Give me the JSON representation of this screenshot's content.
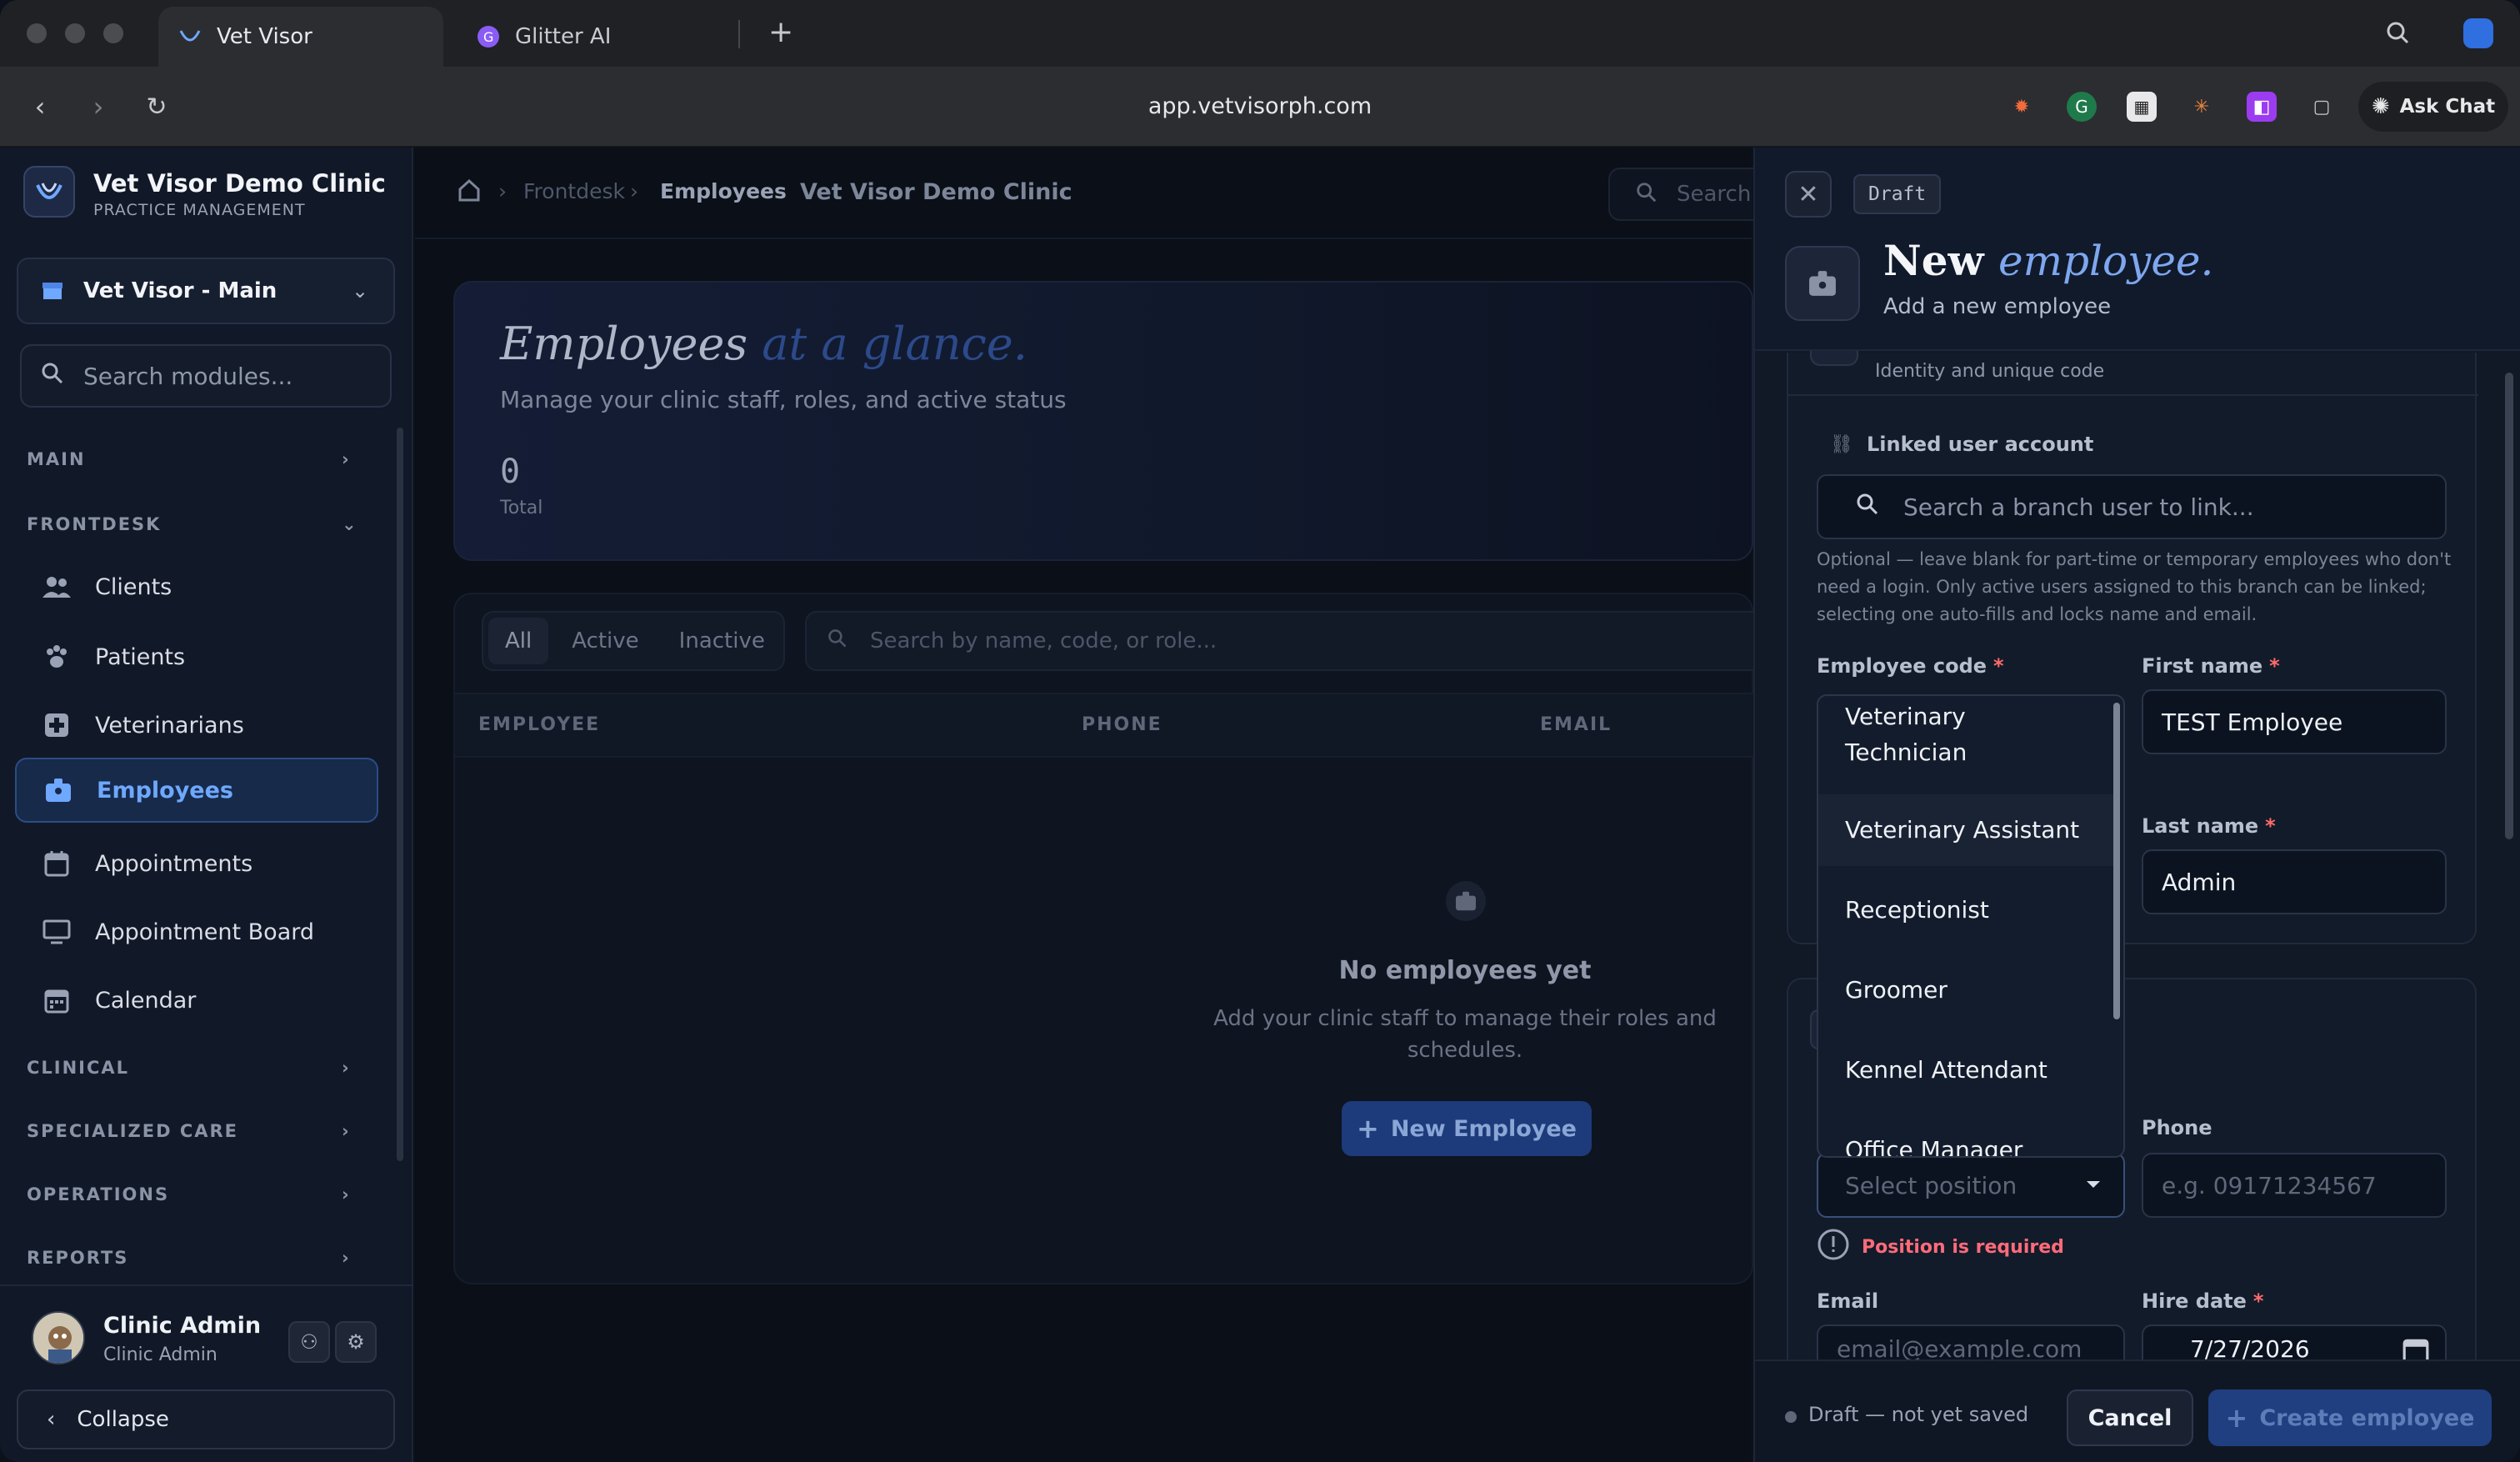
{
  "browser": {
    "tabs": [
      {
        "label": "Vet Visor",
        "active": true
      },
      {
        "label": "Glitter AI",
        "active": false
      }
    ],
    "url": "app.vetvisorph.com",
    "ask_chat": "Ask Chat"
  },
  "sidebar": {
    "brand_title": "Vet Visor Demo Clinic",
    "brand_sub": "PRACTICE MANAGEMENT",
    "branch": "Vet Visor - Main",
    "search_placeholder": "Search modules...",
    "sections": {
      "main": "MAIN",
      "frontdesk": "FRONTDESK",
      "clinical": "CLINICAL",
      "specialized": "SPECIALIZED CARE",
      "operations": "OPERATIONS",
      "reports": "REPORTS"
    },
    "items": [
      {
        "label": "Clients",
        "icon": "users-icon"
      },
      {
        "label": "Patients",
        "icon": "paw-icon"
      },
      {
        "label": "Veterinarians",
        "icon": "medical-cross-icon"
      },
      {
        "label": "Employees",
        "icon": "badge-icon",
        "selected": true
      },
      {
        "label": "Appointments",
        "icon": "calendar-icon"
      },
      {
        "label": "Appointment Board",
        "icon": "monitor-icon"
      },
      {
        "label": "Calendar",
        "icon": "calendar-grid-icon"
      }
    ],
    "user": {
      "name": "Clinic Admin",
      "role": "Clinic Admin"
    },
    "collapse": "Collapse"
  },
  "main": {
    "breadcrumb": [
      "Frontdesk",
      "Employees"
    ],
    "clinic": "Vet Visor Demo Clinic",
    "search_placeholder": "Search",
    "hero": {
      "title_a": "Employees",
      "title_b": "at a glance.",
      "subtitle": "Manage your clinic staff, roles, and active status",
      "count": "0",
      "count_label": "Total"
    },
    "filters": [
      "All",
      "Active",
      "Inactive"
    ],
    "table_search_placeholder": "Search by name, code, or role...",
    "columns": [
      "EMPLOYEE",
      "PHONE",
      "EMAIL"
    ],
    "empty": {
      "title": "No employees yet",
      "desc_1": "Add your clinic staff to manage their roles and",
      "desc_2": "schedules.",
      "button": "New Employee"
    }
  },
  "drawer": {
    "draft_badge": "Draft",
    "title_a": "New",
    "title_b": "employee.",
    "subtitle": "Add a new employee",
    "identity_note": "Identity and unique code",
    "linked_label": "Linked user account",
    "linked_placeholder": "Search a branch user to link...",
    "hint_1": "Optional — leave blank for part-time or temporary employees who don't",
    "hint_2": "need a login. Only active users assigned to this branch can be linked;",
    "hint_3": "selecting one auto-fills and locks name and email.",
    "employee_code_label": "Employee code",
    "first_name_label": "First name",
    "first_name_value": "TEST Employee",
    "last_name_label": "Last name",
    "last_name_value": "Admin",
    "position_options": [
      "Veterinary",
      "Technician",
      "Veterinary Assistant",
      "Receptionist",
      "Groomer",
      "Kennel Attendant",
      "Office Manager"
    ],
    "position_placeholder": "Select position",
    "position_error": "Position is required",
    "phone_label": "Phone",
    "phone_placeholder": "e.g. 09171234567",
    "email_label": "Email",
    "email_placeholder": "email@example.com",
    "hire_date_label": "Hire date",
    "hire_date_value": "7/27/2026",
    "status": "Draft — not yet saved",
    "cancel": "Cancel",
    "create": "Create employee",
    "required_mark": "*"
  },
  "colors": {
    "accent": "#6ea8ff",
    "error": "#ff6b7a",
    "background": "#0c111b"
  }
}
